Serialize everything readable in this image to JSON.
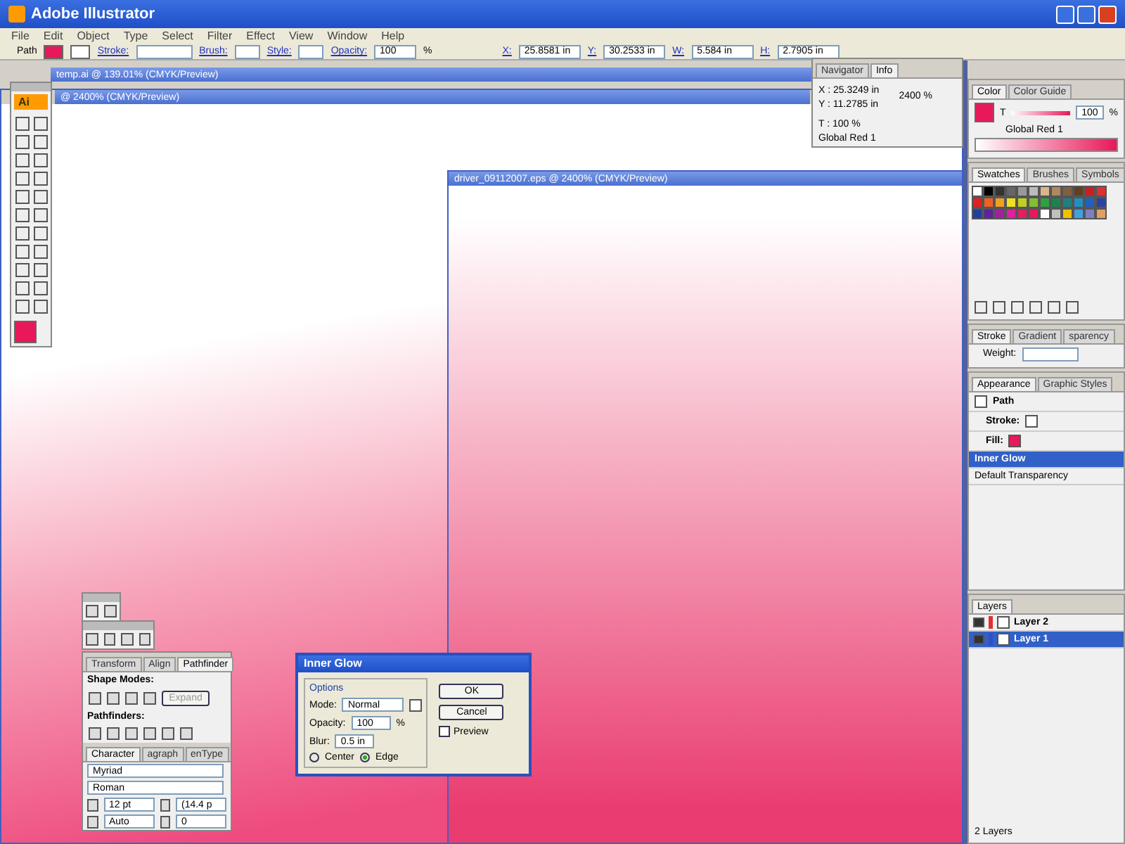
{
  "app_title": "Adobe Illustrator",
  "menu": [
    "File",
    "Edit",
    "Object",
    "Type",
    "Select",
    "Filter",
    "Effect",
    "View",
    "Window",
    "Help"
  ],
  "control_bar": {
    "selection": "Path",
    "links": [
      "Stroke:",
      "Brush:",
      "Style:",
      "Opacity:"
    ],
    "opacity": "100",
    "percent": "%",
    "coords": [
      {
        "label": "X:",
        "value": "25.8581 in"
      },
      {
        "label": "Y:",
        "value": "30.2533 in"
      },
      {
        "label": "W:",
        "value": "5.584 in"
      },
      {
        "label": "H:",
        "value": "2.7905 in"
      }
    ]
  },
  "documents": [
    {
      "title": "temp.ai @ 139.01% (CMYK/Preview)"
    },
    {
      "title": "@ 2400% (CMYK/Preview)"
    },
    {
      "title": "driver_09112007.eps @ 2400% (CMYK/Preview)"
    }
  ],
  "tools": {
    "logo": "Ai"
  },
  "info_panel": {
    "tabs": [
      {
        "label": "Navigator",
        "selected": false
      },
      {
        "label": "Info",
        "selected": true
      }
    ],
    "x": "X : 25.3249 in",
    "y": "Y : 11.2785 in",
    "zoom": "2400 %",
    "tint": "T : 100 %",
    "swatch": "Global Red 1"
  },
  "color_panel": {
    "tabs": [
      {
        "label": "Color",
        "selected": true
      },
      {
        "label": "Color Guide",
        "selected": false
      }
    ],
    "tint_label": "T",
    "level": 1,
    "value": "100",
    "percent": "%",
    "swatch": "Global Red 1"
  },
  "swatches_panel": {
    "tabs": [
      {
        "label": "Swatches",
        "selected": true
      },
      {
        "label": "Brushes",
        "selected": false
      },
      {
        "label": "Symbols",
        "selected": false
      }
    ]
  },
  "stroke_panel": {
    "tabs": [
      {
        "label": "Stroke",
        "selected": true
      },
      {
        "label": "Gradient",
        "selected": false
      },
      {
        "label": "sparency",
        "selected": false
      }
    ],
    "weight": "Weight:"
  },
  "appearance_panel": {
    "tabs": [
      {
        "label": "Appearance",
        "selected": true
      },
      {
        "label": "Graphic Styles",
        "selected": false
      }
    ],
    "items": [
      {
        "kind": "header",
        "label": "Path",
        "selected": false
      },
      {
        "kind": "stroke",
        "label": "Stroke:",
        "selected": false
      },
      {
        "kind": "fill",
        "label": "Fill:",
        "selected": false
      },
      {
        "kind": "effect",
        "label": "Inner Glow",
        "selected": true
      },
      {
        "kind": "effect",
        "label": "Default Transparency",
        "selected": false
      }
    ]
  },
  "layers_panel": {
    "tabs": [
      {
        "label": "Layers",
        "selected": true
      }
    ],
    "layers": [
      {
        "name": "Layer 2",
        "color": "#e03030",
        "selected": false
      },
      {
        "name": "Layer 1",
        "color": "#3050c0",
        "selected": true
      }
    ],
    "count": "2 Layers"
  },
  "pathfinder_panel": {
    "tabs": [
      {
        "label": "Transform",
        "selected": false
      },
      {
        "label": "Align",
        "selected": false
      },
      {
        "label": "Pathfinder",
        "selected": true
      }
    ],
    "shape_modes": "Shape Modes:",
    "expand": "Expand",
    "pathfinders": "Pathfinders:"
  },
  "character_panel": {
    "tabs": [
      {
        "label": "Character",
        "selected": true
      },
      {
        "label": "agraph",
        "selected": false
      },
      {
        "label": "enType",
        "selected": false
      }
    ],
    "font": "Myriad",
    "style": "Roman",
    "size": "12 pt",
    "leading": "(14.4 p",
    "kerning": "Auto",
    "tracking": "0"
  },
  "dialog": {
    "title": "Inner Glow",
    "group": "Options",
    "mode_label": "Mode:",
    "mode": "Normal",
    "opacity_label": "Opacity:",
    "opacity": "100",
    "percent": "%",
    "blur_label": "Blur:",
    "blur": "0.5 in",
    "radios": [
      {
        "label": "Center",
        "selected": false
      },
      {
        "label": "Edge",
        "selected": true
      }
    ],
    "buttons": [
      "OK",
      "Cancel"
    ],
    "preview": {
      "label": "Preview",
      "checked": false
    }
  }
}
